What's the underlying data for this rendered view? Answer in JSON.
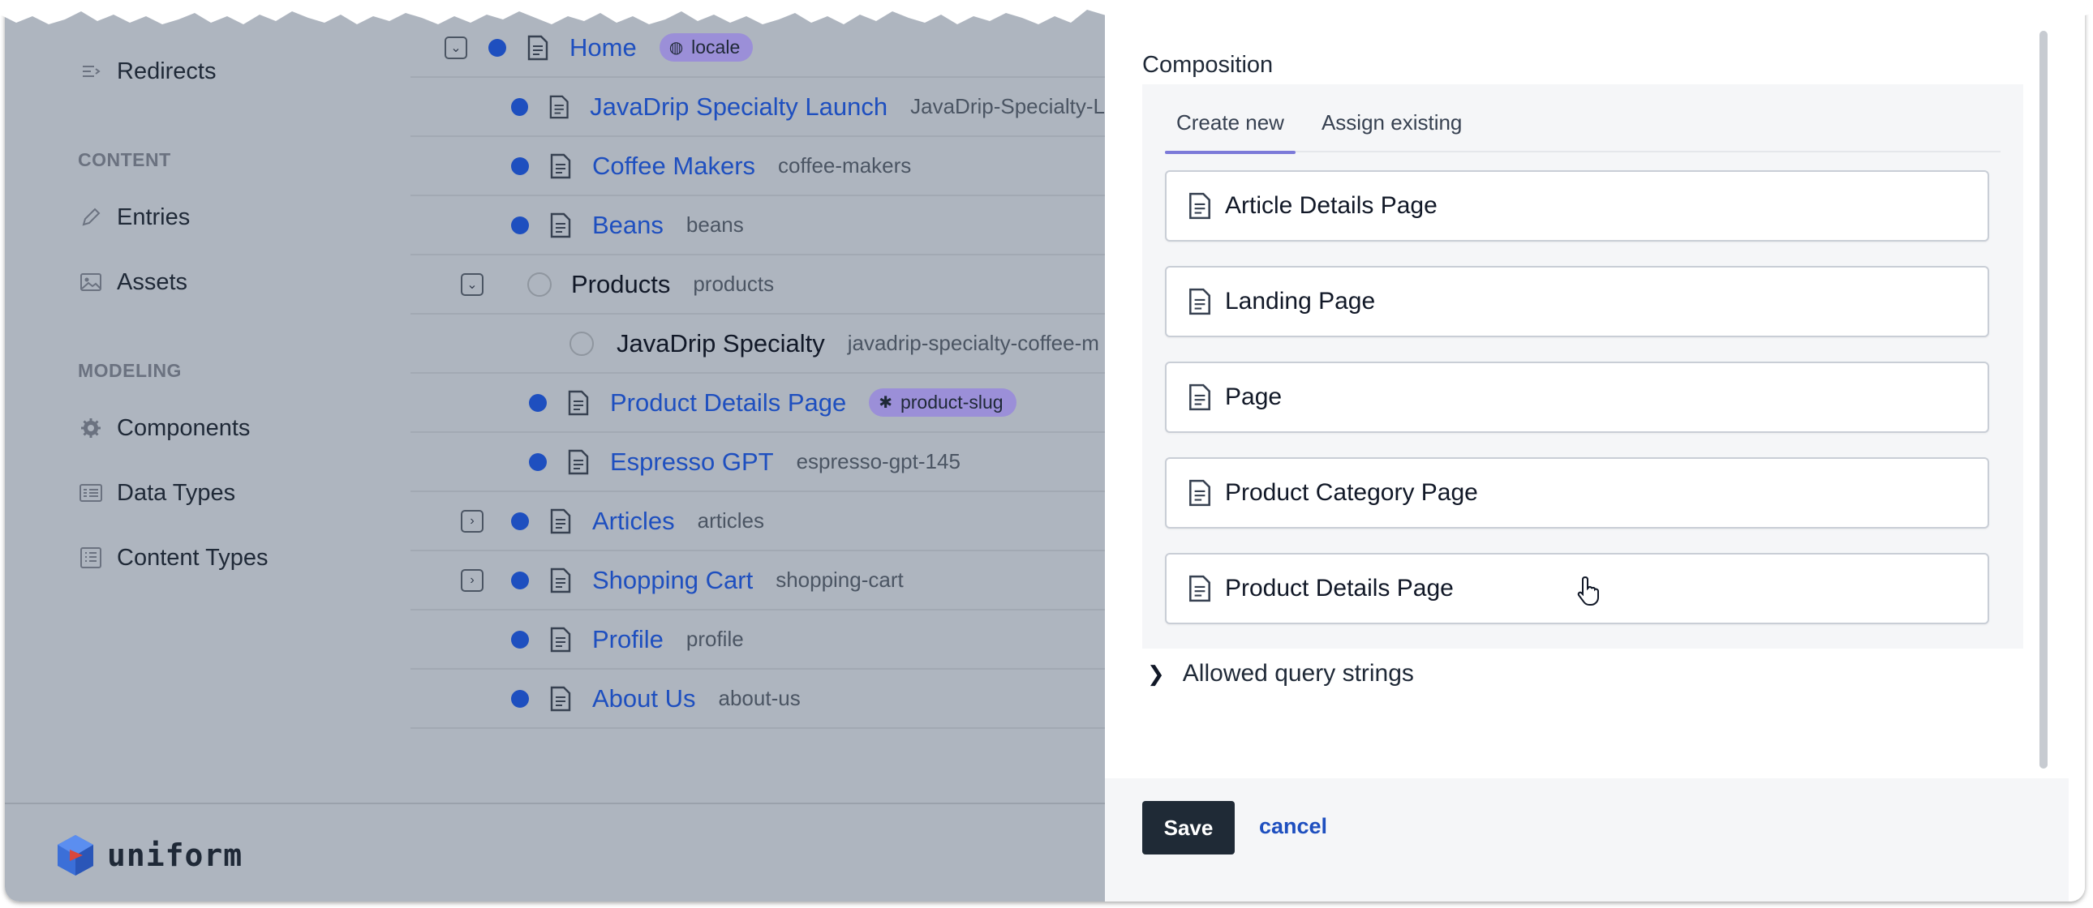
{
  "sidebar": {
    "items_top": [
      {
        "label": "Redirects",
        "icon": "redirect-icon"
      }
    ],
    "content_heading": "CONTENT",
    "content_items": [
      {
        "label": "Entries",
        "icon": "pencil-icon"
      },
      {
        "label": "Assets",
        "icon": "image-icon"
      }
    ],
    "modeling_heading": "MODELING",
    "modeling_items": [
      {
        "label": "Components",
        "icon": "gear-icon"
      },
      {
        "label": "Data Types",
        "icon": "data-types-icon"
      },
      {
        "label": "Content Types",
        "icon": "content-types-icon"
      }
    ]
  },
  "brand": {
    "name": "uniform"
  },
  "tree": {
    "rows": [
      {
        "label": "Home",
        "slug": "",
        "pill": "locale",
        "pill_icon": "globe-icon",
        "linked": true
      },
      {
        "label": "JavaDrip Specialty Launch",
        "slug": "JavaDrip-Specialty-L",
        "linked": true
      },
      {
        "label": "Coffee Makers",
        "slug": "coffee-makers",
        "linked": true
      },
      {
        "label": "Beans",
        "slug": "beans",
        "linked": true
      },
      {
        "label": "Products",
        "slug": "products",
        "linked": false
      },
      {
        "label": "JavaDrip Specialty",
        "slug": "javadrip-specialty-coffee-m",
        "linked": false
      },
      {
        "label": "Product Details Page",
        "slug": "",
        "pill": "product-slug",
        "pill_icon": "asterisk-icon",
        "linked": true
      },
      {
        "label": "Espresso GPT",
        "slug": "espresso-gpt-145",
        "linked": true
      },
      {
        "label": "Articles",
        "slug": "articles",
        "linked": true
      },
      {
        "label": "Shopping Cart",
        "slug": "shopping-cart",
        "linked": true
      },
      {
        "label": "Profile",
        "slug": "profile",
        "linked": true
      },
      {
        "label": "About Us",
        "slug": "about-us",
        "linked": true
      }
    ]
  },
  "drawer": {
    "section_title": "Composition",
    "tabs": [
      {
        "label": "Create new",
        "active": true
      },
      {
        "label": "Assign existing",
        "active": false
      }
    ],
    "options": [
      {
        "label": "Article Details Page"
      },
      {
        "label": "Landing Page"
      },
      {
        "label": "Page"
      },
      {
        "label": "Product Category Page"
      },
      {
        "label": "Product Details Page"
      }
    ],
    "collapsible_label": "Allowed query strings",
    "save_label": "Save",
    "cancel_label": "cancel"
  },
  "colors": {
    "accent": "#1e4fbf",
    "tab_indicator": "#7c7ad9",
    "pill": "#9b8fd8",
    "save_button": "#1f2a36",
    "overlay": "#aeb5bf"
  }
}
